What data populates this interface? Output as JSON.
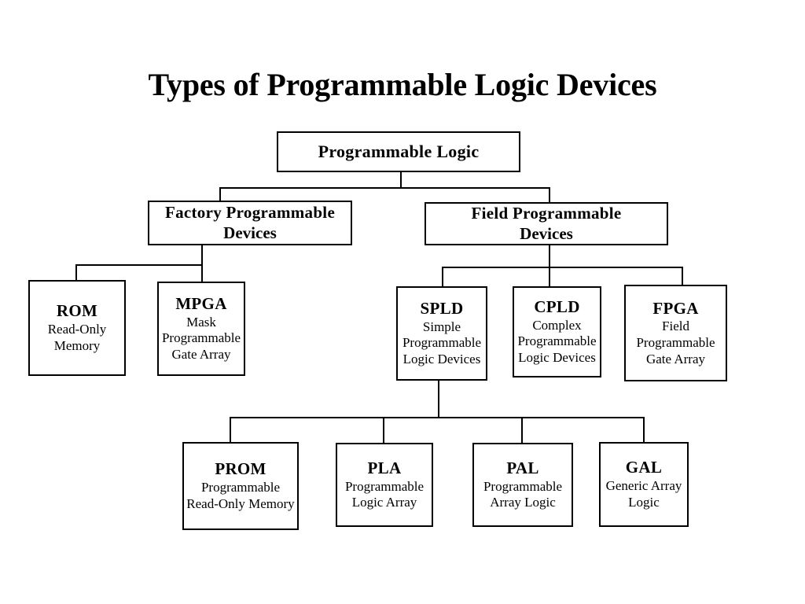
{
  "page": {
    "title": "Types of Programmable Logic Devices",
    "background_color": "#ffffff",
    "line_color": "#000000",
    "text_color": "#000000"
  },
  "diagram": {
    "type": "tree",
    "nodes": {
      "root": {
        "abbr": "Programmable Logic",
        "desc": []
      },
      "factory": {
        "abbr": "Factory Programmable",
        "desc": [
          "Devices"
        ]
      },
      "field": {
        "abbr": "Field Programmable",
        "desc": [
          "Devices"
        ]
      },
      "rom": {
        "abbr": "ROM",
        "desc": [
          "Read-Only",
          "Memory"
        ]
      },
      "mpga": {
        "abbr": "MPGA",
        "desc": [
          "Mask",
          "Programmable",
          "Gate Array"
        ]
      },
      "spld": {
        "abbr": "SPLD",
        "desc": [
          "Simple",
          "Programmable",
          "Logic Devices"
        ]
      },
      "cpld": {
        "abbr": "CPLD",
        "desc": [
          "Complex",
          "Programmable",
          "Logic Devices"
        ]
      },
      "fpga": {
        "abbr": "FPGA",
        "desc": [
          "Field",
          "Programmable",
          "Gate Array"
        ]
      },
      "prom": {
        "abbr": "PROM",
        "desc": [
          "Programmable",
          "Read-Only Memory"
        ]
      },
      "pla": {
        "abbr": "PLA",
        "desc": [
          "Programmable",
          "Logic Array"
        ]
      },
      "pal": {
        "abbr": "PAL",
        "desc": [
          "Programmable",
          "Array Logic"
        ]
      },
      "gal": {
        "abbr": "GAL",
        "desc": [
          "Generic Array",
          "Logic"
        ]
      }
    },
    "edges": [
      {
        "from": "root",
        "to": "factory"
      },
      {
        "from": "root",
        "to": "field"
      },
      {
        "from": "factory",
        "to": "rom"
      },
      {
        "from": "factory",
        "to": "mpga"
      },
      {
        "from": "field",
        "to": "spld"
      },
      {
        "from": "field",
        "to": "cpld"
      },
      {
        "from": "field",
        "to": "fpga"
      },
      {
        "from": "spld",
        "to": "prom"
      },
      {
        "from": "spld",
        "to": "pla"
      },
      {
        "from": "spld",
        "to": "pal"
      },
      {
        "from": "spld",
        "to": "gal"
      }
    ]
  }
}
